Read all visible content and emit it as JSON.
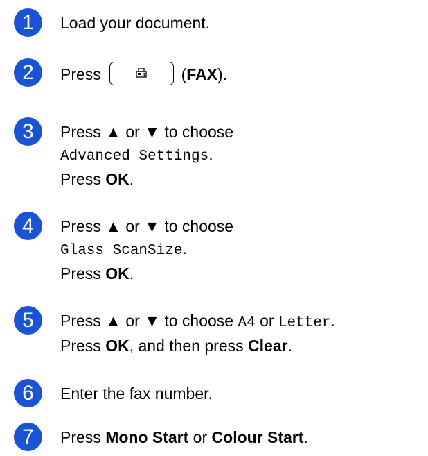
{
  "steps": [
    {
      "number": "1",
      "text": "Load your document."
    },
    {
      "number": "2",
      "text_press": "Press",
      "text_open": "(",
      "text_bold": "FAX",
      "text_close": ")."
    },
    {
      "number": "3",
      "text_a": "Press ▲ or ▼ to choose",
      "mono": "Advanced Settings",
      "mono_end": ".",
      "text_b": "Press ",
      "bold_b": "OK",
      "end_b": "."
    },
    {
      "number": "4",
      "text_a": "Press ▲ or ▼ to choose",
      "mono": "Glass ScanSize",
      "mono_end": ".",
      "text_b": "Press ",
      "bold_b": "OK",
      "end_b": "."
    },
    {
      "number": "5",
      "text_a": "Press ▲ or ▼ to choose ",
      "mono_a": "A4",
      "text_or": " or ",
      "mono_b": "Letter",
      "mono_end": ".",
      "text_b": "Press ",
      "bold_ok": "OK",
      "text_then": ", and then press ",
      "bold_clear": "Clear",
      "end_b": "."
    },
    {
      "number": "6",
      "text": "Enter the fax number."
    },
    {
      "number": "7",
      "text_a": "Press ",
      "bold_a": "Mono Start",
      "text_or": " or ",
      "bold_b": "Colour Start",
      "end": "."
    }
  ],
  "colors": {
    "step_circle": "#1a53d3"
  },
  "icons": {
    "fax_button": "fax-icon"
  }
}
